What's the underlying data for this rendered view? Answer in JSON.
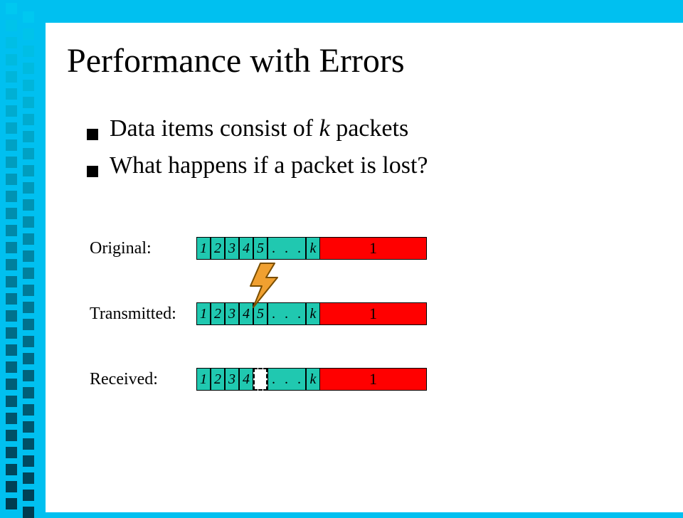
{
  "title": "Performance with Errors",
  "bullets": [
    {
      "pre": "Data items consist of ",
      "em": "k",
      "post": " packets"
    },
    {
      "pre": "What happens if a packet is lost?",
      "em": "",
      "post": ""
    }
  ],
  "rows": {
    "original": {
      "label": "Original:",
      "cells": [
        "1",
        "2",
        "3",
        "4",
        "5"
      ],
      "dots": ". . .",
      "k": "k",
      "red": "1"
    },
    "transmitted": {
      "label": "Transmitted:",
      "cells": [
        "1",
        "2",
        "3",
        "4",
        "5"
      ],
      "dots": ". . .",
      "k": "k",
      "red": "1"
    },
    "received": {
      "label": "Received:",
      "cells": [
        "1",
        "2",
        "3",
        "4"
      ],
      "lost": "",
      "dots": ". . .",
      "k": "k",
      "red": "1"
    }
  },
  "colors": {
    "bg": "#00C0F0",
    "cell": "#20C8B0",
    "red": "#FF0000",
    "bolt_fill": "#F0A030",
    "bolt_stroke": "#7A4E00"
  }
}
